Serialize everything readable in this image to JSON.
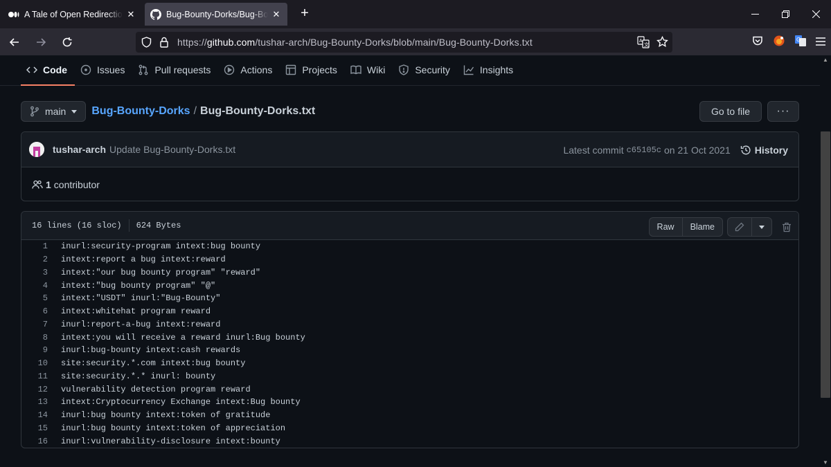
{
  "browser": {
    "tabs": [
      {
        "title": "A Tale of Open Redirection to Stored XSS",
        "active": false
      },
      {
        "title": "Bug-Bounty-Dorks/Bug-Bounty-Dorks.txt",
        "active": true
      }
    ],
    "url_prefix": "https://",
    "url_domain": "github.com",
    "url_path": "/tushar-arch/Bug-Bounty-Dorks/blob/main/Bug-Bounty-Dorks.txt"
  },
  "repo_nav": {
    "items": [
      {
        "label": "Code",
        "icon": "code-icon"
      },
      {
        "label": "Issues",
        "icon": "issue-icon"
      },
      {
        "label": "Pull requests",
        "icon": "pull-request-icon"
      },
      {
        "label": "Actions",
        "icon": "play-icon"
      },
      {
        "label": "Projects",
        "icon": "table-icon"
      },
      {
        "label": "Wiki",
        "icon": "book-icon"
      },
      {
        "label": "Security",
        "icon": "shield-icon"
      },
      {
        "label": "Insights",
        "icon": "graph-icon"
      }
    ]
  },
  "breadcrumb": {
    "branch": "main",
    "repo": "Bug-Bounty-Dorks",
    "separator": "/",
    "file": "Bug-Bounty-Dorks.txt",
    "go_to_file": "Go to file",
    "more": "···"
  },
  "commit": {
    "author": "tushar-arch",
    "message": "Update Bug-Bounty-Dorks.txt",
    "latest_label": "Latest commit",
    "sha": "c65105c",
    "date": "on 21 Oct 2021",
    "history_label": "History",
    "contributors_count": "1",
    "contributors_label": "contributor"
  },
  "file": {
    "lines_info": "16 lines (16 sloc)",
    "size": "624 Bytes",
    "raw_label": "Raw",
    "blame_label": "Blame",
    "lines": [
      "inurl:security-program intext:bug bounty",
      "intext:report a bug intext:reward",
      "intext:\"our bug bounty program\" \"reward\"",
      "intext:\"bug bounty program\" \"@\"",
      "intext:\"USDT\" inurl:\"Bug-Bounty\"",
      "intext:whitehat program reward",
      "inurl:report-a-bug intext:reward",
      "intext:you will receive a reward inurl:Bug bounty",
      "inurl:bug-bounty intext:cash rewards",
      "site:security.*.com intext:bug bounty",
      "site:security.*.* inurl: bounty",
      "vulnerability detection program reward",
      "intext:Cryptocurrency Exchange intext:Bug bounty",
      "inurl:bug bounty intext:token of gratitude",
      "inurl:bug bounty intext:token of appreciation",
      "inurl:vulnerability-disclosure intext:bounty"
    ]
  }
}
